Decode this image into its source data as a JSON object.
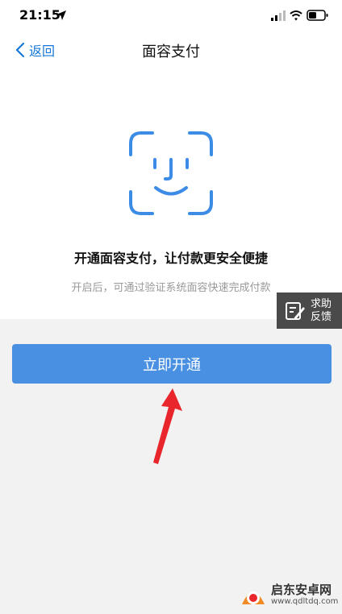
{
  "status_bar": {
    "time": "21:15"
  },
  "nav": {
    "back_label": "返回",
    "title": "面容支付"
  },
  "main": {
    "headline": "开通面容支付，让付款更安全便捷",
    "subline": "开启后，可通过验证系统面容快速完成付款",
    "primary_button": "立即开通"
  },
  "help_widget": {
    "line1": "求助",
    "line2": "反馈"
  },
  "watermark": {
    "name": "启东安卓网",
    "url": "www.qdltdq.com"
  },
  "colors": {
    "accent": "#4a90e2",
    "link": "#1677d9",
    "face_icon": "#3c8ce6",
    "arrow": "#e8262c"
  }
}
